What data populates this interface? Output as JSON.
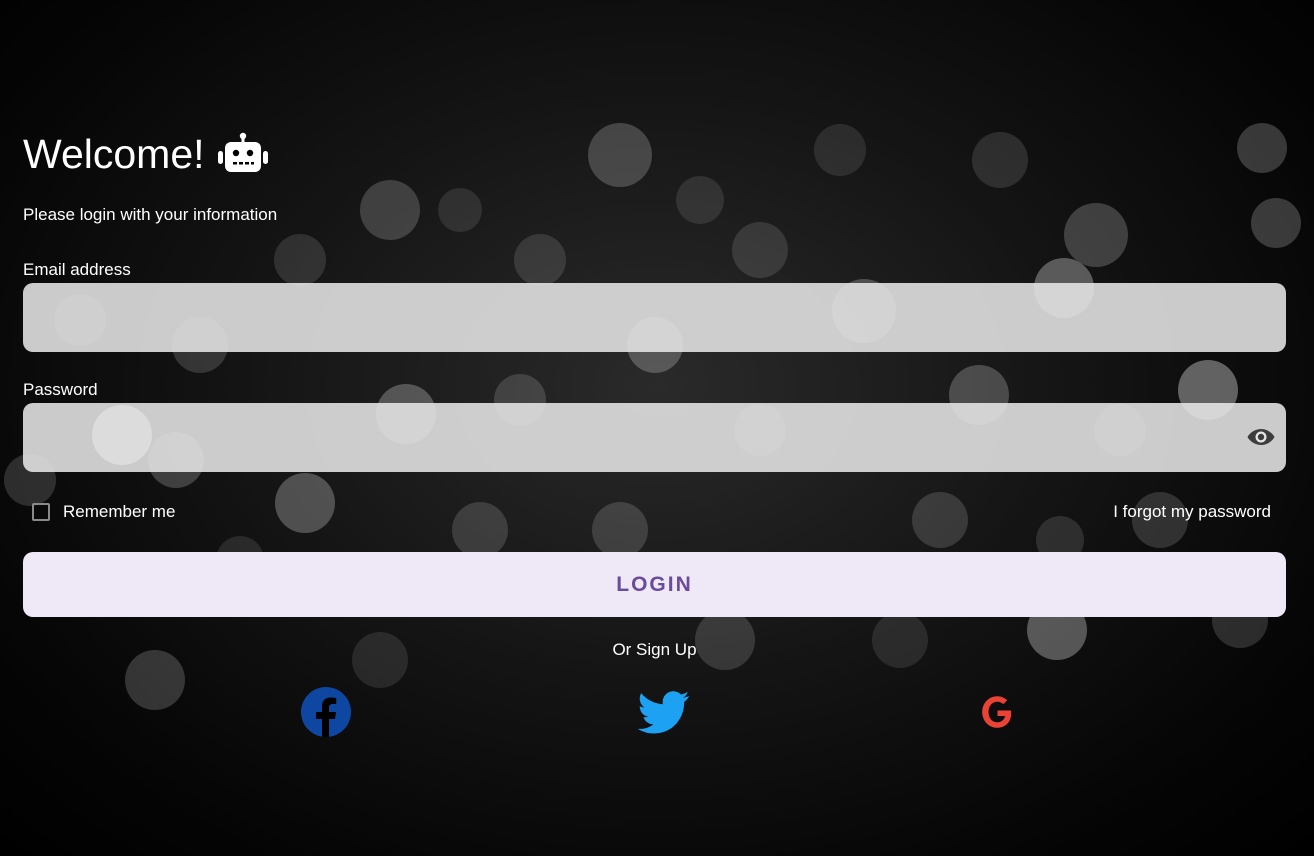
{
  "header": {
    "title": "Welcome!",
    "robot_icon": "robot-icon",
    "subtitle": "Please login with your information"
  },
  "form": {
    "email_label": "Email address",
    "email_value": "",
    "email_placeholder": "",
    "password_label": "Password",
    "password_value": "",
    "password_placeholder": "",
    "visibility_icon": "eye-icon",
    "remember_label": "Remember me",
    "remember_checked": false,
    "forgot_label": "I forgot my password",
    "login_label": "LOGIN"
  },
  "signup": {
    "label": "Or Sign Up",
    "providers": [
      {
        "name": "facebook",
        "icon": "facebook-icon",
        "color": "#0d47a1"
      },
      {
        "name": "twitter",
        "icon": "twitter-icon",
        "color": "#1da1f2"
      },
      {
        "name": "google",
        "icon": "google-icon",
        "color": "#ea4335"
      }
    ]
  },
  "colors": {
    "background": "#000000",
    "input_fill": "#e6e6e6",
    "button_fill": "#efe8f6",
    "button_text": "#6a4c9c"
  }
}
